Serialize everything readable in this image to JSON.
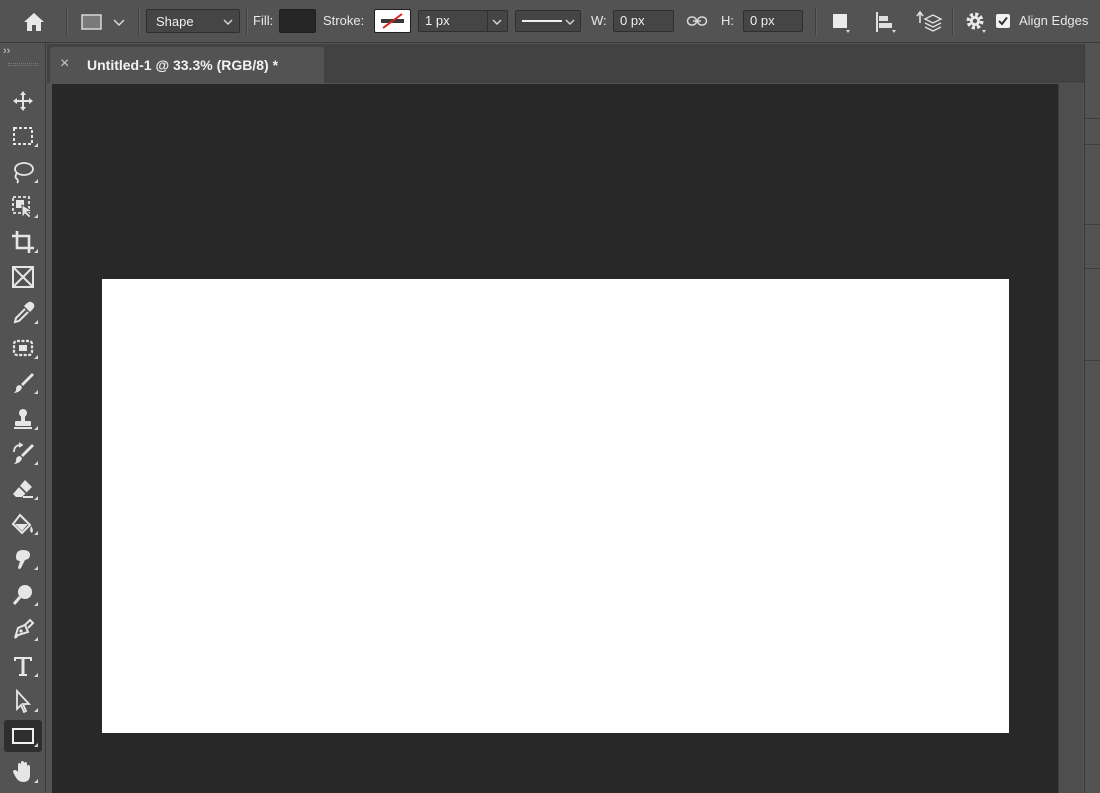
{
  "options_bar": {
    "tool_mode": "Shape",
    "fill_label": "Fill:",
    "fill_color": "#262626",
    "stroke_label": "Stroke:",
    "stroke_width": "1 px",
    "width_label": "W:",
    "width_value": "0 px",
    "height_label": "H:",
    "height_value": "0 px",
    "align_edges_label": "Align Edges",
    "align_edges_checked": true
  },
  "document_tab": {
    "title": "Untitled-1 @ 33.3% (RGB/8) *",
    "close_glyph": "×"
  },
  "toolbar": {
    "collapse_glyph": "››",
    "tools": [
      {
        "name": "move-tool",
        "icon": "move-icon",
        "active": false
      },
      {
        "name": "rectangular-marquee-tool",
        "icon": "marquee-icon",
        "active": false
      },
      {
        "name": "lasso-tool",
        "icon": "lasso-icon",
        "active": false
      },
      {
        "name": "object-selection-tool",
        "icon": "object-selection-icon",
        "active": false
      },
      {
        "name": "crop-tool",
        "icon": "crop-icon",
        "active": false
      },
      {
        "name": "frame-tool",
        "icon": "frame-icon",
        "active": false
      },
      {
        "name": "eyedropper-tool",
        "icon": "eyedropper-icon",
        "active": false
      },
      {
        "name": "healing-brush-tool",
        "icon": "bandage-icon",
        "active": false
      },
      {
        "name": "brush-tool",
        "icon": "brush-icon",
        "active": false
      },
      {
        "name": "clone-stamp-tool",
        "icon": "stamp-icon",
        "active": false
      },
      {
        "name": "history-brush-tool",
        "icon": "history-brush-icon",
        "active": false
      },
      {
        "name": "eraser-tool",
        "icon": "eraser-icon",
        "active": false
      },
      {
        "name": "paint-bucket-tool",
        "icon": "paint-bucket-icon",
        "active": false
      },
      {
        "name": "smudge-tool",
        "icon": "smudge-icon",
        "active": false
      },
      {
        "name": "dodge-tool",
        "icon": "dodge-icon",
        "active": false
      },
      {
        "name": "pen-tool",
        "icon": "pen-icon",
        "active": false
      },
      {
        "name": "type-tool",
        "icon": "type-icon",
        "active": false
      },
      {
        "name": "path-selection-tool",
        "icon": "arrow-icon",
        "active": false
      },
      {
        "name": "rectangle-tool",
        "icon": "rectangle-icon",
        "active": true
      },
      {
        "name": "hand-tool",
        "icon": "hand-icon",
        "active": false
      }
    ]
  },
  "colors": {
    "panel": "#535353",
    "workspace": "#282828",
    "canvas": "#ffffff",
    "active_tool_bg": "#2e2e2e"
  }
}
